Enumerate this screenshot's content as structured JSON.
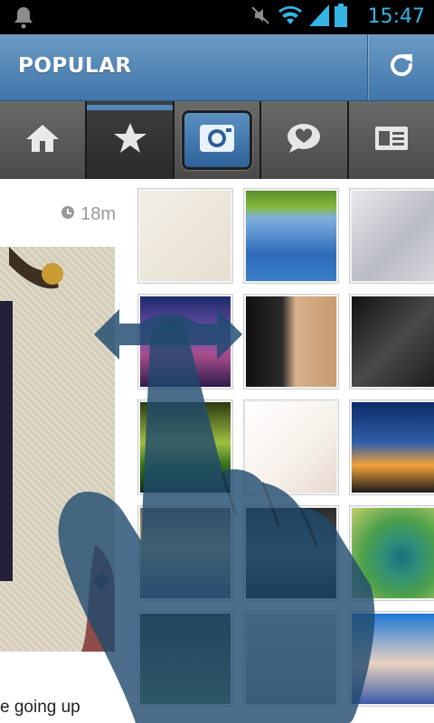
{
  "status_bar": {
    "time": "15:47",
    "icons": [
      "notification-bell-icon",
      "mute-icon",
      "wifi-icon",
      "signal-icon",
      "battery-icon"
    ]
  },
  "header": {
    "title": "POPULAR",
    "refresh_icon": "refresh-icon"
  },
  "tabs": [
    {
      "name": "home",
      "icon": "home-icon",
      "active": false
    },
    {
      "name": "popular",
      "icon": "star-icon",
      "active": true
    },
    {
      "name": "camera",
      "icon": "camera-icon",
      "active": false
    },
    {
      "name": "news",
      "icon": "speech-heart-icon",
      "active": false
    },
    {
      "name": "profile",
      "icon": "profile-card-icon",
      "active": false
    }
  ],
  "feed": {
    "time_ago": "18m",
    "caption": "e going up"
  },
  "colors": {
    "header_blue": "#4f87bb",
    "status_blue": "#33b5e5",
    "gesture_overlay": "#1f4a6e"
  },
  "grid": [
    {
      "name": "photo-1",
      "bg": "linear-gradient(135deg,#f3efe6,#e6dfd0)"
    },
    {
      "name": "photo-2",
      "bg": "linear-gradient(#5a8f2a 0,#84b83a 18%,#7fb1e0 30%,#2f6bb8 70%,#3a7fc9 100%)"
    },
    {
      "name": "photo-3",
      "bg": "linear-gradient(135deg,#e8e8ea,#b9bbc4 55%,#d9dade)"
    },
    {
      "name": "photo-4",
      "bg": "linear-gradient(#1c2a6b,#7a55b2 45%,#a84d8c 65%,#2d1b4b)"
    },
    {
      "name": "photo-5",
      "bg": "linear-gradient(90deg,#101010 0,#2a2a2a 40%,#d7b08b 55%,#c99a6f 100%)"
    },
    {
      "name": "photo-6",
      "bg": "linear-gradient(135deg,#111,#4a4a4a 50%,#1a1a1a)"
    },
    {
      "name": "photo-7",
      "bg": "linear-gradient(#2c3a12,#9fbf42 45%,#35701d 70%,#0f2a12)"
    },
    {
      "name": "photo-8",
      "bg": "linear-gradient(135deg,#fff,#f6f0ea 60%,#e7d9cf)"
    },
    {
      "name": "photo-9",
      "bg": "linear-gradient(#0c2a66,#2f5fa8 45%,#f2a23a 70%,#1a1a1a)"
    },
    {
      "name": "photo-10",
      "bg": "linear-gradient(#7a6f5c,#c7b57d 45%,#4f5f7a)"
    },
    {
      "name": "photo-11",
      "bg": "linear-gradient(#2a2a2a,#5b5b5b 50%,#111)"
    },
    {
      "name": "photo-12",
      "bg": "radial-gradient(circle at 55% 55%,#1b6c7a 0,#2e8f7a 25%,#4ea04a 55%,#c3d06d 100%)"
    },
    {
      "name": "photo-13",
      "bg": "linear-gradient(#2a3a24,#6a8a4a)"
    },
    {
      "name": "photo-14",
      "bg": "linear-gradient(#cfd8d0,#9ab0a0)"
    },
    {
      "name": "photo-15",
      "bg": "linear-gradient(#1e78d6,#e9d2c0 55%,#3a5aa7)"
    }
  ]
}
